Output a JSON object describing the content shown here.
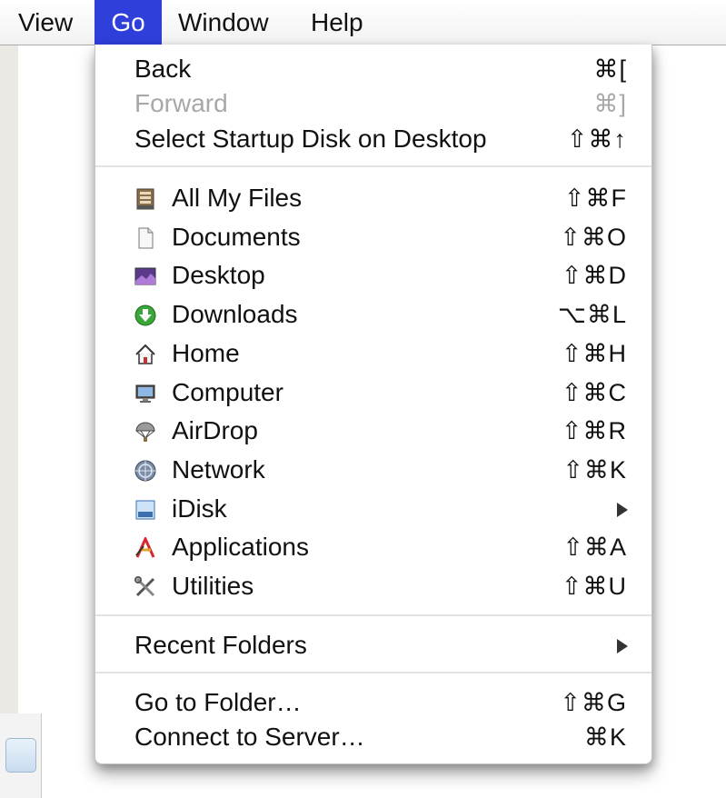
{
  "menubar": {
    "items": [
      {
        "label": "View"
      },
      {
        "label": "Go"
      },
      {
        "label": "Window"
      },
      {
        "label": "Help"
      }
    ],
    "selected": "Go"
  },
  "menu": {
    "group1": [
      {
        "label": "Back",
        "shortcut": "⌘[",
        "enabled": true
      },
      {
        "label": "Forward",
        "shortcut": "⌘]",
        "enabled": false
      },
      {
        "label": "Select Startup Disk on Desktop",
        "shortcut": "⇧⌘↑",
        "enabled": true
      }
    ],
    "group2": [
      {
        "label": "All My Files",
        "shortcut": "⇧⌘F",
        "icon": "all-my-files-icon"
      },
      {
        "label": "Documents",
        "shortcut": "⇧⌘O",
        "icon": "documents-icon"
      },
      {
        "label": "Desktop",
        "shortcut": "⇧⌘D",
        "icon": "desktop-icon"
      },
      {
        "label": "Downloads",
        "shortcut": "⌥⌘L",
        "icon": "downloads-icon"
      },
      {
        "label": "Home",
        "shortcut": "⇧⌘H",
        "icon": "home-icon"
      },
      {
        "label": "Computer",
        "shortcut": "⇧⌘C",
        "icon": "computer-icon"
      },
      {
        "label": "AirDrop",
        "shortcut": "⇧⌘R",
        "icon": "airdrop-icon"
      },
      {
        "label": "Network",
        "shortcut": "⇧⌘K",
        "icon": "network-icon"
      },
      {
        "label": "iDisk",
        "shortcut": "",
        "icon": "idisk-icon",
        "submenu": true
      },
      {
        "label": "Applications",
        "shortcut": "⇧⌘A",
        "icon": "applications-icon"
      },
      {
        "label": "Utilities",
        "shortcut": "⇧⌘U",
        "icon": "utilities-icon"
      }
    ],
    "group3": [
      {
        "label": "Recent Folders",
        "submenu": true
      }
    ],
    "group4": [
      {
        "label": "Go to Folder…",
        "shortcut": "⇧⌘G"
      },
      {
        "label": "Connect to Server…",
        "shortcut": "⌘K"
      }
    ]
  },
  "colors": {
    "selection": "#2f3fd9",
    "disabled_text": "#a8a8a8"
  }
}
